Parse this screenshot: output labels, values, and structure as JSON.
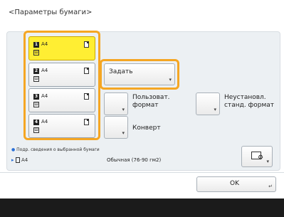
{
  "header": {
    "title": "<Параметры бумаги>"
  },
  "drawers": [
    {
      "num": "1",
      "size": "A4",
      "type": "Ш",
      "selected": true
    },
    {
      "num": "2",
      "size": "A4",
      "type": "Ш",
      "selected": false
    },
    {
      "num": "3",
      "size": "A4",
      "type": "Ш",
      "selected": false
    },
    {
      "num": "4",
      "size": "A4",
      "type": "Ш",
      "selected": false
    }
  ],
  "buttons": {
    "set": "Задать",
    "custom": "Пользоват.\nформат",
    "nonstandard": "Неустановл.\nстанд. формат",
    "envelope": "Конверт",
    "ok": "OK"
  },
  "info": {
    "heading": "Подр. сведения о выбранной бумаги",
    "size": "A4",
    "paper_type": "Обычная (76-90 гм2)"
  },
  "icons": {
    "doc": "document-icon",
    "settings": "paper-settings-icon",
    "chevron": "chevron-right-icon"
  },
  "colors": {
    "accent": "#f5a623",
    "selected": "#ffee33",
    "panel": "#ecf0f3"
  }
}
